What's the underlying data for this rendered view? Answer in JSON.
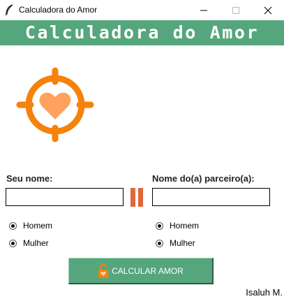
{
  "window": {
    "title": "Calculadora do Amor",
    "icon": "feather-icon",
    "controls": [
      "minimize-icon",
      "maximize-icon",
      "close-icon"
    ]
  },
  "header": {
    "title": "Calculadora do Amor",
    "background": "#55a67d",
    "text_color": "#ffffff"
  },
  "logo": {
    "icon": "target-heart-icon",
    "ring_color": "#f5820d",
    "heart_color": "#ffa25e"
  },
  "form": {
    "left": {
      "label": "Seu nome:",
      "value": "",
      "options": [
        {
          "label": "Homem",
          "selected": true
        },
        {
          "label": "Mulher",
          "selected": true
        }
      ]
    },
    "separator_icon": "pause-icon",
    "separator_color": "#e0683a",
    "right": {
      "label": "Nome do(a) parceiro(a):",
      "value": "",
      "options": [
        {
          "label": "Homem",
          "selected": true
        },
        {
          "label": "Mulher",
          "selected": true
        }
      ]
    }
  },
  "action": {
    "label": "CALCULAR AMOR",
    "icon": "lock-heart-icon",
    "background": "#55a67d"
  },
  "footer": {
    "author": "Isaluh M."
  }
}
